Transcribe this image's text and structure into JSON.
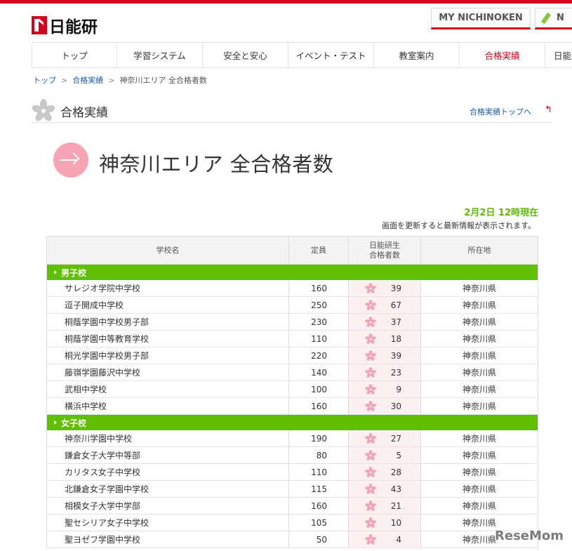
{
  "header": {
    "logo_text": "日能研",
    "my_button": "MY NICHINOKEN",
    "new_button": "N"
  },
  "nav": {
    "items": [
      "トップ",
      "学習システム",
      "安全と安心",
      "イベント・テスト",
      "教室案内",
      "合格実績",
      "日能"
    ],
    "active": "合格実績"
  },
  "breadcrumb": {
    "items": [
      "トップ",
      "合格実績",
      "神奈川エリア 全合格者数"
    ]
  },
  "section": {
    "title": "合格実績",
    "link": "合格実績トップへ"
  },
  "page_title": "神奈川エリア 全合格者数",
  "update": {
    "time": "2月2日 12時現在",
    "note": "画面を更新すると最新情報が表示されます。"
  },
  "table": {
    "headers": {
      "school": "学校名",
      "capacity": "定員",
      "passed_line1": "日能研生",
      "passed_line2": "合格者数",
      "location": "所在地"
    },
    "groups": [
      {
        "name": "男子校",
        "rows": [
          {
            "school": "サレジオ学院中学校",
            "capacity": "160",
            "passed": "39",
            "location": "神奈川県"
          },
          {
            "school": "逗子開成中学校",
            "capacity": "250",
            "passed": "67",
            "location": "神奈川県"
          },
          {
            "school": "桐蔭学園中学校男子部",
            "capacity": "230",
            "passed": "37",
            "location": "神奈川県"
          },
          {
            "school": "桐蔭学園中等教育学校",
            "capacity": "110",
            "passed": "18",
            "location": "神奈川県"
          },
          {
            "school": "桐光学園中学校男子部",
            "capacity": "220",
            "passed": "39",
            "location": "神奈川県"
          },
          {
            "school": "藤嶺学園藤沢中学校",
            "capacity": "140",
            "passed": "23",
            "location": "神奈川県"
          },
          {
            "school": "武相中学校",
            "capacity": "100",
            "passed": "9",
            "location": "神奈川県"
          },
          {
            "school": "横浜中学校",
            "capacity": "160",
            "passed": "30",
            "location": "神奈川県"
          }
        ]
      },
      {
        "name": "女子校",
        "rows": [
          {
            "school": "神奈川学園中学校",
            "capacity": "190",
            "passed": "27",
            "location": "神奈川県"
          },
          {
            "school": "鎌倉女子大学中等部",
            "capacity": "80",
            "passed": "5",
            "location": "神奈川県"
          },
          {
            "school": "カリタス女子中学校",
            "capacity": "110",
            "passed": "28",
            "location": "神奈川県"
          },
          {
            "school": "北鎌倉女子学園中学校",
            "capacity": "115",
            "passed": "43",
            "location": "神奈川県"
          },
          {
            "school": "相模女子大学中学部",
            "capacity": "160",
            "passed": "21",
            "location": "神奈川県"
          },
          {
            "school": "聖セシリア女子中学校",
            "capacity": "105",
            "passed": "10",
            "location": "神奈川県"
          },
          {
            "school": "聖ヨゼフ学園中学校",
            "capacity": "50",
            "passed": "4",
            "location": "神奈川県"
          }
        ]
      }
    ]
  },
  "watermark": "ReseMom",
  "colors": {
    "brand_red": "#d7001a",
    "group_green": "#5fbf00",
    "sakura_pink": "#f7a4b4",
    "link_blue": "#1a5fb4"
  }
}
